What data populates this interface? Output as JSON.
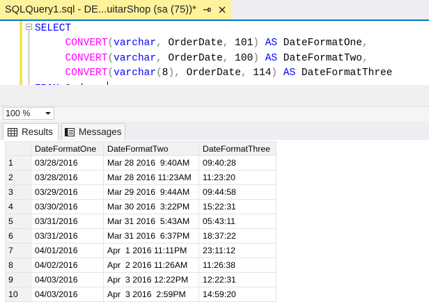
{
  "tab": {
    "title": "SQLQuery1.sql - DE...uitarShop (sa (75))*"
  },
  "colors": {
    "tab_active": "#fff29d",
    "accent": "#007acc",
    "keyword": "#0000ff",
    "function": "#ff00ff",
    "operator": "#808080"
  },
  "editor": {
    "lines": [
      [
        {
          "t": "SELECT",
          "c": "kw"
        }
      ],
      [
        {
          "t": "     ",
          "c": ""
        },
        {
          "t": "CONVERT",
          "c": "fn"
        },
        {
          "t": "(",
          "c": "gr"
        },
        {
          "t": "varchar",
          "c": "kw"
        },
        {
          "t": ",",
          "c": "gr"
        },
        {
          "t": " OrderDate",
          "c": ""
        },
        {
          "t": ",",
          "c": "gr"
        },
        {
          "t": " 101",
          "c": ""
        },
        {
          "t": ")",
          "c": "gr"
        },
        {
          "t": " AS",
          "c": "kw"
        },
        {
          "t": " DateFormatOne",
          "c": ""
        },
        {
          "t": ",",
          "c": "gr"
        }
      ],
      [
        {
          "t": "     ",
          "c": ""
        },
        {
          "t": "CONVERT",
          "c": "fn"
        },
        {
          "t": "(",
          "c": "gr"
        },
        {
          "t": "varchar",
          "c": "kw"
        },
        {
          "t": ",",
          "c": "gr"
        },
        {
          "t": " OrderDate",
          "c": ""
        },
        {
          "t": ",",
          "c": "gr"
        },
        {
          "t": " 100",
          "c": ""
        },
        {
          "t": ")",
          "c": "gr"
        },
        {
          "t": " AS",
          "c": "kw"
        },
        {
          "t": " DateFormatTwo",
          "c": ""
        },
        {
          "t": ",",
          "c": "gr"
        }
      ],
      [
        {
          "t": "     ",
          "c": ""
        },
        {
          "t": "CONVERT",
          "c": "fn"
        },
        {
          "t": "(",
          "c": "gr"
        },
        {
          "t": "varchar",
          "c": "kw"
        },
        {
          "t": "(",
          "c": "gr"
        },
        {
          "t": "8",
          "c": ""
        },
        {
          "t": ")",
          "c": "gr"
        },
        {
          "t": ",",
          "c": "gr"
        },
        {
          "t": " OrderDate",
          "c": ""
        },
        {
          "t": ",",
          "c": "gr"
        },
        {
          "t": " 114",
          "c": ""
        },
        {
          "t": ")",
          "c": "gr"
        },
        {
          "t": " AS",
          "c": "kw"
        },
        {
          "t": " DateFormatThree",
          "c": ""
        }
      ],
      [
        {
          "t": "FROM",
          "c": "kw"
        },
        {
          "t": " Orders",
          "c": ""
        },
        {
          "t": ";",
          "c": "gr"
        }
      ]
    ]
  },
  "zoom": {
    "value": "100 %"
  },
  "result_tabs": {
    "results": "Results",
    "messages": "Messages"
  },
  "grid": {
    "columns": [
      "DateFormatOne",
      "DateFormatTwo",
      "DateFormatThree"
    ],
    "rows": [
      {
        "n": "1",
        "a": "03/28/2016",
        "b": "Mar 28 2016  9:40AM",
        "c": "09:40:28"
      },
      {
        "n": "2",
        "a": "03/28/2016",
        "b": "Mar 28 2016 11:23AM",
        "c": "11:23:20"
      },
      {
        "n": "3",
        "a": "03/29/2016",
        "b": "Mar 29 2016  9:44AM",
        "c": "09:44:58"
      },
      {
        "n": "4",
        "a": "03/30/2016",
        "b": "Mar 30 2016  3:22PM",
        "c": "15:22:31"
      },
      {
        "n": "5",
        "a": "03/31/2016",
        "b": "Mar 31 2016  5:43AM",
        "c": "05:43:11"
      },
      {
        "n": "6",
        "a": "03/31/2016",
        "b": "Mar 31 2016  6:37PM",
        "c": "18:37:22"
      },
      {
        "n": "7",
        "a": "04/01/2016",
        "b": "Apr  1 2016 11:11PM",
        "c": "23:11:12"
      },
      {
        "n": "8",
        "a": "04/02/2016",
        "b": "Apr  2 2016 11:26AM",
        "c": "11:26:38"
      },
      {
        "n": "9",
        "a": "04/03/2016",
        "b": "Apr  3 2016 12:22PM",
        "c": "12:22:31"
      },
      {
        "n": "10",
        "a": "04/03/2016",
        "b": "Apr  3 2016  2:59PM",
        "c": "14:59:20"
      }
    ]
  }
}
